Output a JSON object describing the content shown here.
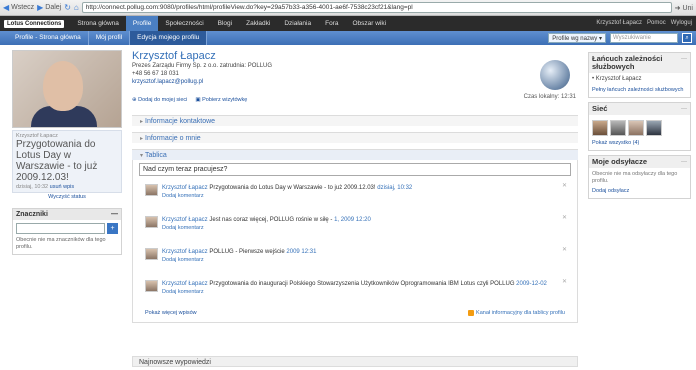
{
  "browser": {
    "back_label": "Wstecz",
    "forward_label": "Dalej",
    "url": "http://connect.pollug.com:9080/profiles/html/profileView.do?key=29a57b33-a356-4001-ae6f-7538c23cf21&lang=pl",
    "right_label": "Uni"
  },
  "app_nav": {
    "logo_text": "Lotus Connections",
    "tabs": [
      "Strona główna",
      "Profile",
      "Społeczności",
      "Blogi",
      "Zakładki",
      "Działania",
      "Fora",
      "Obszar wiki"
    ],
    "active_tab": "Profile",
    "user_name": "Krzysztof Łapacz",
    "user_links": [
      "Pomoc",
      "Wyloguj"
    ]
  },
  "sub_nav": {
    "tabs": [
      "Profile - Strona główna",
      "Mój profil",
      "Edycja mojego profilu"
    ],
    "current_tab": "Edycja mojego profilu",
    "search_scope": "Profile wg nazwy",
    "search_placeholder": "Wyszukiwanie"
  },
  "profile": {
    "name": "Krzysztof Łapacz",
    "title_line": "Prezes Zarządu Firmy Sp. z o.o. zatrudnia: POLLUG",
    "phone": "+48 56 67 18 031",
    "email": "krzysztof.lapacz@pollug.pl",
    "local_time": "Czas lokalny: 12:31",
    "action_add_network": "Dodaj do mojej sieci",
    "action_vcard": "Pobierz wizytówkę"
  },
  "status": {
    "author": "Krzysztof Łapacz",
    "text": "Przygotowania do Lotus Day w Warszawie - to już 2009.12.03!",
    "time": "dzisiaj, 10:32",
    "delete_label": "usuń wpis",
    "clear_label": "Wyczyść status"
  },
  "tag_widget": {
    "title": "Znaczniki",
    "toggle": "—",
    "button": "+",
    "description": "Obecnie nie ma znaczników dla tego profilu."
  },
  "sections": {
    "contact": "Informacje kontaktowe",
    "about": "Informacje o mnie",
    "board": "Tablica"
  },
  "board": {
    "input_placeholder": "Nad czym teraz pracujesz?",
    "posts": [
      {
        "author": "Krzysztof Łapacz",
        "text": "Przygotowania do Lotus Day w Warszawie - to już 2009.12.03!",
        "date": "dzisiaj, 10:32",
        "comment": "Dodaj komentarz"
      },
      {
        "author": "Krzysztof Łapacz",
        "text": "Jest nas coraz więcej, POLLUG rośnie w siłę -",
        "date": "1, 2009 12:20",
        "comment": "Dodaj komentarz"
      },
      {
        "author": "Krzysztof Łapacz",
        "text": "POLLUG - Pierwsze wejście",
        "date": "2009 12:31",
        "comment": "Dodaj komentarz"
      },
      {
        "author": "Krzysztof Łapacz",
        "text": "Przygotowania do inauguracji Polskiego Stowarzyszenia Użytkowników Oprogramowania IBM Lotus czyli POLLUG",
        "date": "2009-12-02",
        "comment": "Dodaj komentarz"
      }
    ],
    "footer_more": "Pokaż więcej wpisów",
    "footer_rss": "Kanał informacyjny dla tablicy profilu"
  },
  "latest_section": "Najnowsze wypowiedzi",
  "right": {
    "reporting": {
      "title": "Łańcuch zależności służbowych",
      "toggle": "—",
      "person": "Krzysztof Łapacz",
      "link": "Pełny łańcuch zależności służbowych"
    },
    "network": {
      "title": "Sieć",
      "toggle": "—",
      "link": "Pokaż wszystko (4)"
    },
    "links": {
      "title": "Moje odsyłacze",
      "toggle": "—",
      "description": "Obecnie nie ma odsyłaczy dla tego profilu.",
      "link": "Dodaj odsyłacz"
    }
  }
}
